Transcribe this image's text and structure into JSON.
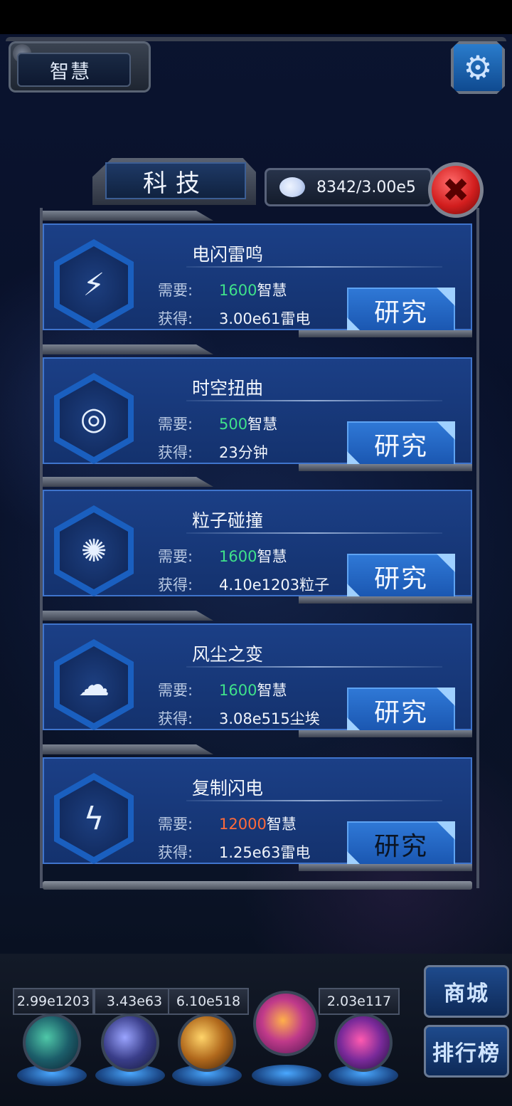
{
  "header": {
    "title": "智慧",
    "settings_icon": "gear-icon"
  },
  "panel": {
    "title": "科技",
    "resource_icon": "brain-icon",
    "resource_value": "8342/3.00e5",
    "close_icon": "close-icon"
  },
  "labels": {
    "require": "需要:",
    "gain": "获得:"
  },
  "techs": [
    {
      "name": "电闪雷鸣",
      "icon": "lightning-strike-icon",
      "cost_num": "1600",
      "cost_unit": "智慧",
      "cost_color": "green",
      "gain": "3.00e61雷电",
      "button": "研究"
    },
    {
      "name": "时空扭曲",
      "icon": "vortex-icon",
      "cost_num": "500",
      "cost_unit": "智慧",
      "cost_color": "green",
      "gain": "23分钟",
      "button": "研究"
    },
    {
      "name": "粒子碰撞",
      "icon": "particle-collision-icon",
      "cost_num": "1600",
      "cost_unit": "智慧",
      "cost_color": "green",
      "gain": "4.10e1203粒子",
      "button": "研究"
    },
    {
      "name": "风尘之变",
      "icon": "dust-cloud-icon",
      "cost_num": "1600",
      "cost_unit": "智慧",
      "cost_color": "green",
      "gain": "3.08e515尘埃",
      "button": "研究"
    },
    {
      "name": "复制闪电",
      "icon": "copy-lightning-icon",
      "cost_num": "12000",
      "cost_unit": "智慧",
      "cost_color": "red",
      "gain": "1.25e63雷电",
      "button": "研究"
    }
  ],
  "bottom": {
    "resources": [
      "2.99e1203",
      "3.43e63",
      "6.10e518",
      "2.03e117"
    ],
    "orbs": [
      "particle-orb-icon",
      "lightning-orb-icon",
      "dust-orb-icon",
      "energy-orb-icon",
      "vortex-orb-icon"
    ],
    "shop": "商城",
    "rank": "排行榜"
  }
}
